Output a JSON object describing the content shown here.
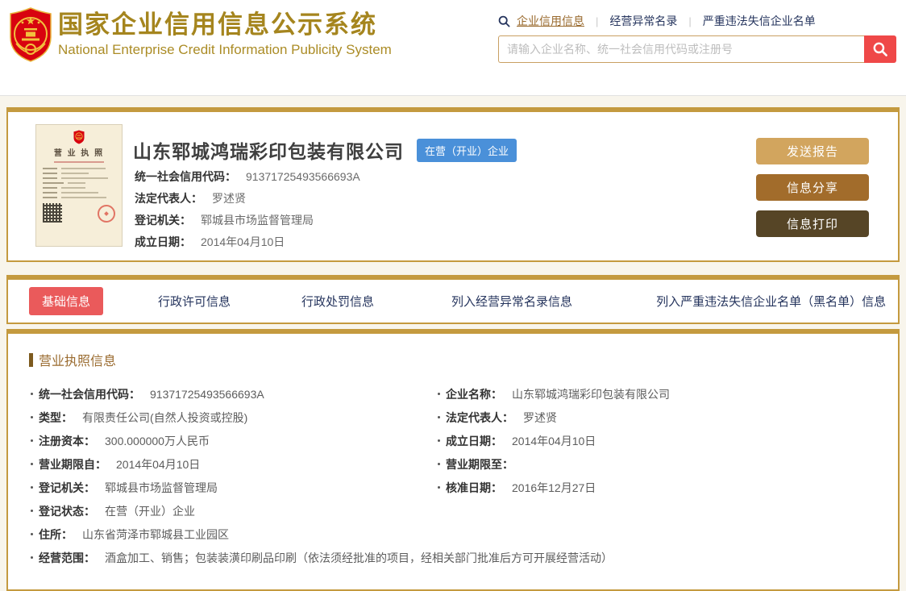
{
  "header": {
    "site_title": "国家企业信用信息公示系统",
    "site_subtitle": "National Enterprise Credit Information Publicity System",
    "search_categories": [
      "企业信用信息",
      "经营异常名录",
      "严重违法失信企业名单"
    ],
    "search": {
      "placeholder": "请输入企业名称、统一社会信用代码或注册号"
    }
  },
  "company_card": {
    "license_title": "营 业 执 照",
    "name": "山东郓城鸿瑞彩印包装有限公司",
    "status_badge": "在营（开业）企业",
    "fields": [
      {
        "label": "统一社会信用代码：",
        "value": "91371725493566693A"
      },
      {
        "label": "法定代表人：",
        "value": "罗述贤"
      },
      {
        "label": "登记机关：",
        "value": "郓城县市场监督管理局"
      },
      {
        "label": "成立日期：",
        "value": "2014年04月10日"
      }
    ],
    "buttons": [
      "发送报告",
      "信息分享",
      "信息打印"
    ]
  },
  "tabs": [
    {
      "label": "基础信息",
      "active": true
    },
    {
      "label": "行政许可信息",
      "active": false
    },
    {
      "label": "行政处罚信息",
      "active": false
    },
    {
      "label": "列入经营异常名录信息",
      "active": false
    },
    {
      "label": "列入严重违法失信企业名单（黑名单）信息",
      "active": false
    }
  ],
  "license_section": {
    "title": "营业执照信息",
    "left_fields": [
      {
        "label": "统一社会信用代码：",
        "value": "91371725493566693A"
      },
      {
        "label": "类型：",
        "value": "有限责任公司(自然人投资或控股)"
      },
      {
        "label": "注册资本：",
        "value": "300.000000万人民币"
      },
      {
        "label": "营业期限自：",
        "value": "2014年04月10日"
      },
      {
        "label": "登记机关：",
        "value": "郓城县市场监督管理局"
      },
      {
        "label": "登记状态：",
        "value": "在营（开业）企业"
      },
      {
        "label": "住所：",
        "value": "山东省菏泽市郓城县工业园区"
      },
      {
        "label": "经营范围：",
        "value": "酒盒加工、销售；包装装潢印刷品印刷（依法须经批准的项目，经相关部门批准后方可开展经营活动）"
      }
    ],
    "right_fields": [
      {
        "label": "企业名称：",
        "value": "山东郓城鸿瑞彩印包装有限公司"
      },
      {
        "label": "法定代表人：",
        "value": "罗述贤"
      },
      {
        "label": "成立日期：",
        "value": "2014年04月10日"
      },
      {
        "label": "营业期限至：",
        "value": ""
      },
      {
        "label": "核准日期：",
        "value": "2016年12月27日"
      }
    ]
  },
  "icons": {
    "logo": "national-emblem",
    "category_search": "search-icon",
    "submit_search": "search-button-icon"
  },
  "colors": {
    "brand_gold": "#a5851e",
    "card_border_gold": "#c49a3f",
    "accent_red": "#ef4848",
    "active_tab_red": "#ea5a5b",
    "status_badge_blue": "#4a90d9",
    "button_light": "#d2a55e",
    "button_medium": "#a26c2b",
    "button_dark": "#564526",
    "link_navy": "#26355e",
    "section_brown": "#9a6b2f",
    "page_background": "#f8f5ec"
  }
}
